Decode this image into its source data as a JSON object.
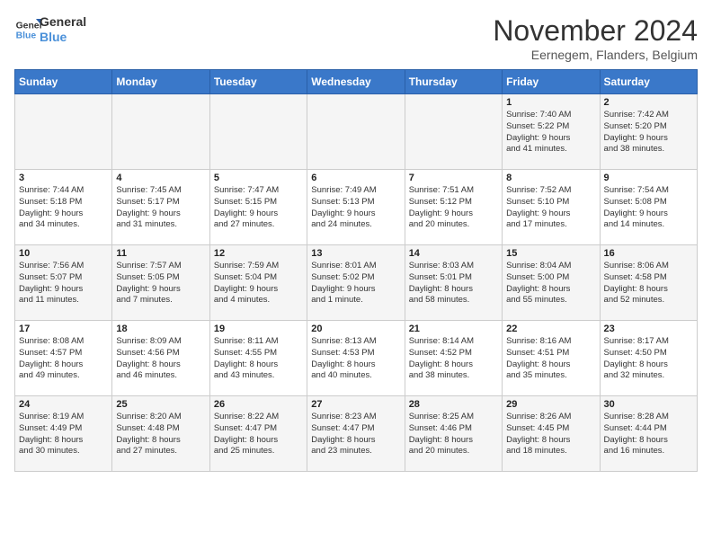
{
  "logo": {
    "line1": "General",
    "line2": "Blue"
  },
  "title": "November 2024",
  "subtitle": "Eernegem, Flanders, Belgium",
  "weekdays": [
    "Sunday",
    "Monday",
    "Tuesday",
    "Wednesday",
    "Thursday",
    "Friday",
    "Saturday"
  ],
  "weeks": [
    [
      {
        "day": "",
        "info": ""
      },
      {
        "day": "",
        "info": ""
      },
      {
        "day": "",
        "info": ""
      },
      {
        "day": "",
        "info": ""
      },
      {
        "day": "",
        "info": ""
      },
      {
        "day": "1",
        "info": "Sunrise: 7:40 AM\nSunset: 5:22 PM\nDaylight: 9 hours\nand 41 minutes."
      },
      {
        "day": "2",
        "info": "Sunrise: 7:42 AM\nSunset: 5:20 PM\nDaylight: 9 hours\nand 38 minutes."
      }
    ],
    [
      {
        "day": "3",
        "info": "Sunrise: 7:44 AM\nSunset: 5:18 PM\nDaylight: 9 hours\nand 34 minutes."
      },
      {
        "day": "4",
        "info": "Sunrise: 7:45 AM\nSunset: 5:17 PM\nDaylight: 9 hours\nand 31 minutes."
      },
      {
        "day": "5",
        "info": "Sunrise: 7:47 AM\nSunset: 5:15 PM\nDaylight: 9 hours\nand 27 minutes."
      },
      {
        "day": "6",
        "info": "Sunrise: 7:49 AM\nSunset: 5:13 PM\nDaylight: 9 hours\nand 24 minutes."
      },
      {
        "day": "7",
        "info": "Sunrise: 7:51 AM\nSunset: 5:12 PM\nDaylight: 9 hours\nand 20 minutes."
      },
      {
        "day": "8",
        "info": "Sunrise: 7:52 AM\nSunset: 5:10 PM\nDaylight: 9 hours\nand 17 minutes."
      },
      {
        "day": "9",
        "info": "Sunrise: 7:54 AM\nSunset: 5:08 PM\nDaylight: 9 hours\nand 14 minutes."
      }
    ],
    [
      {
        "day": "10",
        "info": "Sunrise: 7:56 AM\nSunset: 5:07 PM\nDaylight: 9 hours\nand 11 minutes."
      },
      {
        "day": "11",
        "info": "Sunrise: 7:57 AM\nSunset: 5:05 PM\nDaylight: 9 hours\nand 7 minutes."
      },
      {
        "day": "12",
        "info": "Sunrise: 7:59 AM\nSunset: 5:04 PM\nDaylight: 9 hours\nand 4 minutes."
      },
      {
        "day": "13",
        "info": "Sunrise: 8:01 AM\nSunset: 5:02 PM\nDaylight: 9 hours\nand 1 minute."
      },
      {
        "day": "14",
        "info": "Sunrise: 8:03 AM\nSunset: 5:01 PM\nDaylight: 8 hours\nand 58 minutes."
      },
      {
        "day": "15",
        "info": "Sunrise: 8:04 AM\nSunset: 5:00 PM\nDaylight: 8 hours\nand 55 minutes."
      },
      {
        "day": "16",
        "info": "Sunrise: 8:06 AM\nSunset: 4:58 PM\nDaylight: 8 hours\nand 52 minutes."
      }
    ],
    [
      {
        "day": "17",
        "info": "Sunrise: 8:08 AM\nSunset: 4:57 PM\nDaylight: 8 hours\nand 49 minutes."
      },
      {
        "day": "18",
        "info": "Sunrise: 8:09 AM\nSunset: 4:56 PM\nDaylight: 8 hours\nand 46 minutes."
      },
      {
        "day": "19",
        "info": "Sunrise: 8:11 AM\nSunset: 4:55 PM\nDaylight: 8 hours\nand 43 minutes."
      },
      {
        "day": "20",
        "info": "Sunrise: 8:13 AM\nSunset: 4:53 PM\nDaylight: 8 hours\nand 40 minutes."
      },
      {
        "day": "21",
        "info": "Sunrise: 8:14 AM\nSunset: 4:52 PM\nDaylight: 8 hours\nand 38 minutes."
      },
      {
        "day": "22",
        "info": "Sunrise: 8:16 AM\nSunset: 4:51 PM\nDaylight: 8 hours\nand 35 minutes."
      },
      {
        "day": "23",
        "info": "Sunrise: 8:17 AM\nSunset: 4:50 PM\nDaylight: 8 hours\nand 32 minutes."
      }
    ],
    [
      {
        "day": "24",
        "info": "Sunrise: 8:19 AM\nSunset: 4:49 PM\nDaylight: 8 hours\nand 30 minutes."
      },
      {
        "day": "25",
        "info": "Sunrise: 8:20 AM\nSunset: 4:48 PM\nDaylight: 8 hours\nand 27 minutes."
      },
      {
        "day": "26",
        "info": "Sunrise: 8:22 AM\nSunset: 4:47 PM\nDaylight: 8 hours\nand 25 minutes."
      },
      {
        "day": "27",
        "info": "Sunrise: 8:23 AM\nSunset: 4:47 PM\nDaylight: 8 hours\nand 23 minutes."
      },
      {
        "day": "28",
        "info": "Sunrise: 8:25 AM\nSunset: 4:46 PM\nDaylight: 8 hours\nand 20 minutes."
      },
      {
        "day": "29",
        "info": "Sunrise: 8:26 AM\nSunset: 4:45 PM\nDaylight: 8 hours\nand 18 minutes."
      },
      {
        "day": "30",
        "info": "Sunrise: 8:28 AM\nSunset: 4:44 PM\nDaylight: 8 hours\nand 16 minutes."
      }
    ]
  ]
}
